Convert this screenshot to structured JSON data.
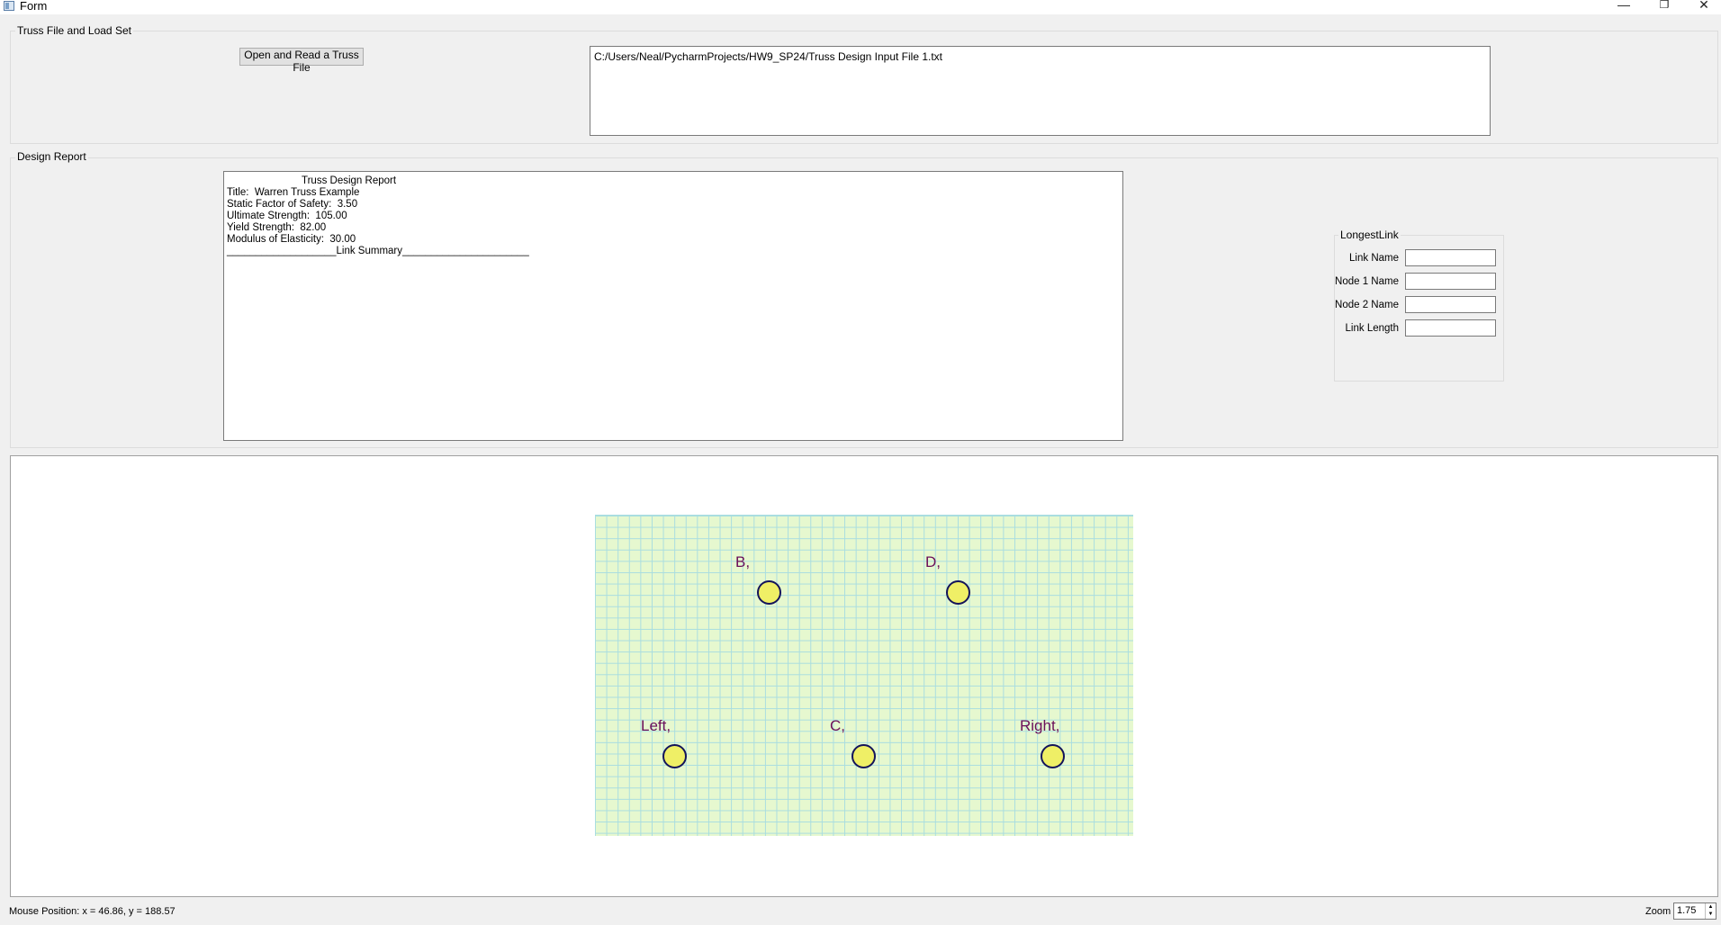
{
  "window": {
    "title": "Form",
    "minimize_glyph": "—",
    "restore_glyph": "❐",
    "close_glyph": "✕"
  },
  "file_group": {
    "title": "Truss File and Load Set",
    "open_button": "Open and Read a Truss File",
    "file_path": "C:/Users/Neal/PycharmProjects/HW9_SP24/Truss Design Input File 1.txt"
  },
  "report_group": {
    "title": "Design Report",
    "report": {
      "heading": "Truss Design Report",
      "lines": [
        "Title:  Warren Truss Example",
        "Static Factor of Safety:  3.50",
        "Ultimate Strength:  105.00",
        "Yield Strength:  82.00",
        "Modulus of Elasticity:  30.00",
        "___________________Link Summary______________________"
      ]
    }
  },
  "longest_link": {
    "title": "LongestLink",
    "fields": [
      {
        "label": "Link Name",
        "value": ""
      },
      {
        "label": "Node 1 Name",
        "value": ""
      },
      {
        "label": "Node 2 Name",
        "value": ""
      },
      {
        "label": "Link Length",
        "value": ""
      }
    ]
  },
  "drawing": {
    "nodes": [
      {
        "label": "B,"
      },
      {
        "label": "D,"
      },
      {
        "label": "Left,"
      },
      {
        "label": "C,"
      },
      {
        "label": "Right,"
      }
    ]
  },
  "status": {
    "mouse_position": "Mouse Position:  x = 46.86, y = 188.57",
    "zoom_label": "Zoom",
    "zoom_value": "1.75"
  },
  "colors": {
    "grid_background": "#e6f8cf",
    "grid_lines": "#a9dde0",
    "node_fill": "#efef66",
    "node_outline": "#14145a",
    "node_label": "#6b0f5a"
  }
}
